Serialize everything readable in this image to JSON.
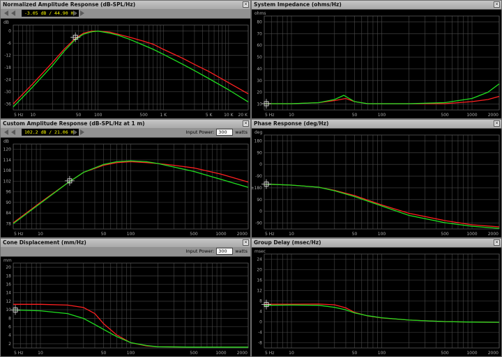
{
  "colors": {
    "red": "#ff2020",
    "green": "#20e020",
    "readout_text": "#ffff00"
  },
  "icons": {
    "close": "close-icon",
    "prev": "arrow-left-icon",
    "next": "arrow-right-icon",
    "marker": "crosshair-icon"
  },
  "panels": {
    "amplitude": {
      "title": "Normalized Amplitude Response (dB-SPL/Hz)",
      "readout": "-3.05 dB / 44.90 Hz",
      "unit": "dB",
      "y_ticks": [
        "0",
        "-6",
        "-12",
        "-18",
        "-24",
        "-30",
        "-36"
      ],
      "x_ticks": [
        "5 Hz",
        "10",
        "50",
        "100",
        "500",
        "1 K",
        "5 K",
        "10 K",
        "20 K"
      ]
    },
    "impedance": {
      "title": "System Impedance (ohms/Hz)",
      "unit": "ohms",
      "y_ticks": [
        "80",
        "70",
        "60",
        "50",
        "40",
        "30",
        "20",
        "10"
      ],
      "x_ticks": [
        "5 Hz",
        "10",
        "50",
        "100",
        "500",
        "1000",
        "2000"
      ]
    },
    "custom_amplitude": {
      "title": "Custom Amplitude Response (dB-SPL/Hz at 1 m)",
      "readout": "102.2 dB / 21.06 Hz",
      "power_label": "Input Power:",
      "power_value": "300",
      "power_unit": "watts",
      "unit": "dB",
      "y_ticks": [
        "120",
        "114",
        "108",
        "102",
        "96",
        "90",
        "84",
        "78"
      ],
      "x_ticks": [
        "5 Hz",
        "10",
        "50",
        "100",
        "500",
        "1000",
        "2000"
      ]
    },
    "phase": {
      "title": "Phase Response (deg/Hz)",
      "unit": "deg",
      "y_ticks": [
        "180",
        "90",
        "0",
        "-90",
        "±180",
        "90",
        "0",
        "-90"
      ],
      "x_ticks": [
        "5 Hz",
        "10",
        "50",
        "100",
        "500",
        "1000",
        "2000"
      ]
    },
    "cone": {
      "title": "Cone Displacement (mm/Hz)",
      "power_label": "Input Power:",
      "power_value": "300",
      "power_unit": "watts",
      "unit": "mm",
      "y_ticks": [
        "20",
        "18",
        "16",
        "14",
        "12",
        "10",
        "8",
        "6",
        "4",
        "2"
      ],
      "x_ticks": [
        "5 Hz",
        "10",
        "50",
        "100",
        "500",
        "1000",
        "2000"
      ]
    },
    "group_delay": {
      "title": "Group Delay (msec/Hz)",
      "unit": "msec",
      "y_ticks": [
        "24",
        "20",
        "16",
        "12",
        "8",
        "4",
        "0",
        "-4",
        "-8"
      ],
      "x_ticks": [
        "5 Hz",
        "10",
        "50",
        "100",
        "500",
        "1000",
        "2000"
      ]
    }
  },
  "chart_data": [
    {
      "type": "line",
      "title": "Normalized Amplitude Response (dB-SPL/Hz)",
      "ylabel": "dB",
      "x_scale": "log",
      "xlim": [
        5,
        20000
      ],
      "ylim": [
        -39,
        3
      ],
      "series": [
        {
          "color": "#ff2020",
          "x": [
            5,
            10,
            20,
            30,
            45,
            60,
            80,
            100,
            150,
            200,
            300,
            500,
            700,
            1000,
            2000,
            3000,
            5000,
            10000,
            20000
          ],
          "y": [
            -36,
            -26,
            -15.5,
            -9,
            -3.5,
            -1,
            0,
            0,
            -0.5,
            -1.5,
            -3,
            -5,
            -6.5,
            -9,
            -13.5,
            -16.5,
            -20,
            -25.5,
            -31
          ]
        },
        {
          "color": "#20e020",
          "x": [
            5,
            10,
            20,
            30,
            45,
            60,
            80,
            100,
            150,
            200,
            300,
            500,
            700,
            1000,
            2000,
            3000,
            5000,
            10000,
            20000
          ],
          "y": [
            -37.5,
            -27.5,
            -17,
            -10,
            -4,
            -1.5,
            -0.3,
            0,
            -1,
            -2,
            -4,
            -7,
            -9,
            -11.5,
            -16.5,
            -19.5,
            -23.5,
            -29,
            -35
          ]
        }
      ]
    },
    {
      "type": "line",
      "title": "System Impedance (ohms/Hz)",
      "ylabel": "ohms",
      "x_scale": "log",
      "xlim": [
        5,
        2000
      ],
      "ylim": [
        0,
        90
      ],
      "series": [
        {
          "color": "#ff2020",
          "x": [
            5,
            10,
            20,
            30,
            40,
            50,
            70,
            100,
            200,
            500,
            1000,
            1500,
            2000
          ],
          "y": [
            6,
            6,
            7,
            9,
            11,
            8,
            6,
            6,
            6,
            6,
            8,
            10,
            13
          ]
        },
        {
          "color": "#20e020",
          "x": [
            5,
            10,
            20,
            30,
            38,
            50,
            70,
            100,
            200,
            500,
            1000,
            1500,
            2000
          ],
          "y": [
            6,
            6,
            7,
            10,
            14,
            8,
            6,
            6,
            6,
            7,
            11,
            17,
            25
          ]
        }
      ]
    },
    {
      "type": "line",
      "title": "Custom Amplitude Response (dB-SPL/Hz at 1 m)",
      "ylabel": "dB",
      "x_scale": "log",
      "xlim": [
        5,
        2000
      ],
      "ylim": [
        75,
        123
      ],
      "series": [
        {
          "color": "#ff2020",
          "x": [
            5,
            10,
            20,
            30,
            50,
            70,
            100,
            150,
            200,
            300,
            500,
            1000,
            2000
          ],
          "y": [
            78.5,
            90,
            101,
            107,
            111,
            112.5,
            113,
            112.5,
            112,
            111,
            109.5,
            106,
            101.5
          ]
        },
        {
          "color": "#20e020",
          "x": [
            5,
            10,
            20,
            30,
            50,
            70,
            100,
            150,
            200,
            300,
            500,
            1000,
            2000
          ],
          "y": [
            78,
            89.5,
            101,
            107,
            111.5,
            113,
            113.5,
            113,
            112,
            110,
            107.5,
            103,
            98.5
          ]
        }
      ]
    },
    {
      "type": "line",
      "title": "Phase Response (deg/Hz)",
      "ylabel": "deg",
      "x_scale": "log",
      "xlim": [
        5,
        2000
      ],
      "ylim": [
        -225,
        225
      ],
      "series": [
        {
          "color": "#ff2020",
          "x": [
            5,
            10,
            20,
            30,
            50,
            100,
            200,
            500,
            1000,
            2000
          ],
          "y": [
            -10,
            -15,
            -25,
            -40,
            -65,
            -110,
            -150,
            -185,
            -205,
            -215
          ]
        },
        {
          "color": "#20e020",
          "x": [
            5,
            10,
            20,
            30,
            50,
            100,
            200,
            500,
            1000,
            2000
          ],
          "y": [
            -10,
            -15,
            -25,
            -42,
            -70,
            -115,
            -160,
            -195,
            -212,
            -222
          ]
        }
      ]
    },
    {
      "type": "line",
      "title": "Cone Displacement (mm/Hz)",
      "ylabel": "mm",
      "x_scale": "log",
      "xlim": [
        5,
        2000
      ],
      "ylim": [
        0,
        21
      ],
      "series": [
        {
          "color": "#ff2020",
          "x": [
            5,
            10,
            20,
            30,
            40,
            50,
            70,
            100,
            150,
            200,
            500,
            1000,
            2000
          ],
          "y": [
            10.8,
            10.8,
            10.6,
            10,
            8.5,
            6,
            3.2,
            1.3,
            0.5,
            0.3,
            0.2,
            0.2,
            0.2
          ]
        },
        {
          "color": "#20e020",
          "x": [
            5,
            10,
            20,
            30,
            40,
            50,
            70,
            100,
            150,
            200,
            500,
            1000,
            2000
          ],
          "y": [
            9.4,
            9.2,
            8.5,
            7.3,
            5.8,
            4.6,
            2.8,
            1.3,
            0.6,
            0.3,
            0.2,
            0.2,
            0.2
          ]
        }
      ]
    },
    {
      "type": "line",
      "title": "Group Delay (msec/Hz)",
      "ylabel": "msec",
      "x_scale": "log",
      "xlim": [
        5,
        2000
      ],
      "ylim": [
        -10,
        27
      ],
      "series": [
        {
          "color": "#ff2020",
          "x": [
            5,
            10,
            20,
            30,
            40,
            50,
            70,
            100,
            200,
            500,
            1000,
            2000
          ],
          "y": [
            7.2,
            7.2,
            7.3,
            7,
            5.8,
            4,
            2.6,
            1.8,
            1,
            0.4,
            0.2,
            0.1
          ]
        },
        {
          "color": "#20e020",
          "x": [
            5,
            10,
            20,
            30,
            40,
            50,
            70,
            100,
            200,
            500,
            1000,
            2000
          ],
          "y": [
            6.8,
            6.9,
            6.8,
            6,
            5,
            3.8,
            2.7,
            1.9,
            1,
            0.4,
            0.2,
            0.1
          ]
        }
      ]
    }
  ]
}
